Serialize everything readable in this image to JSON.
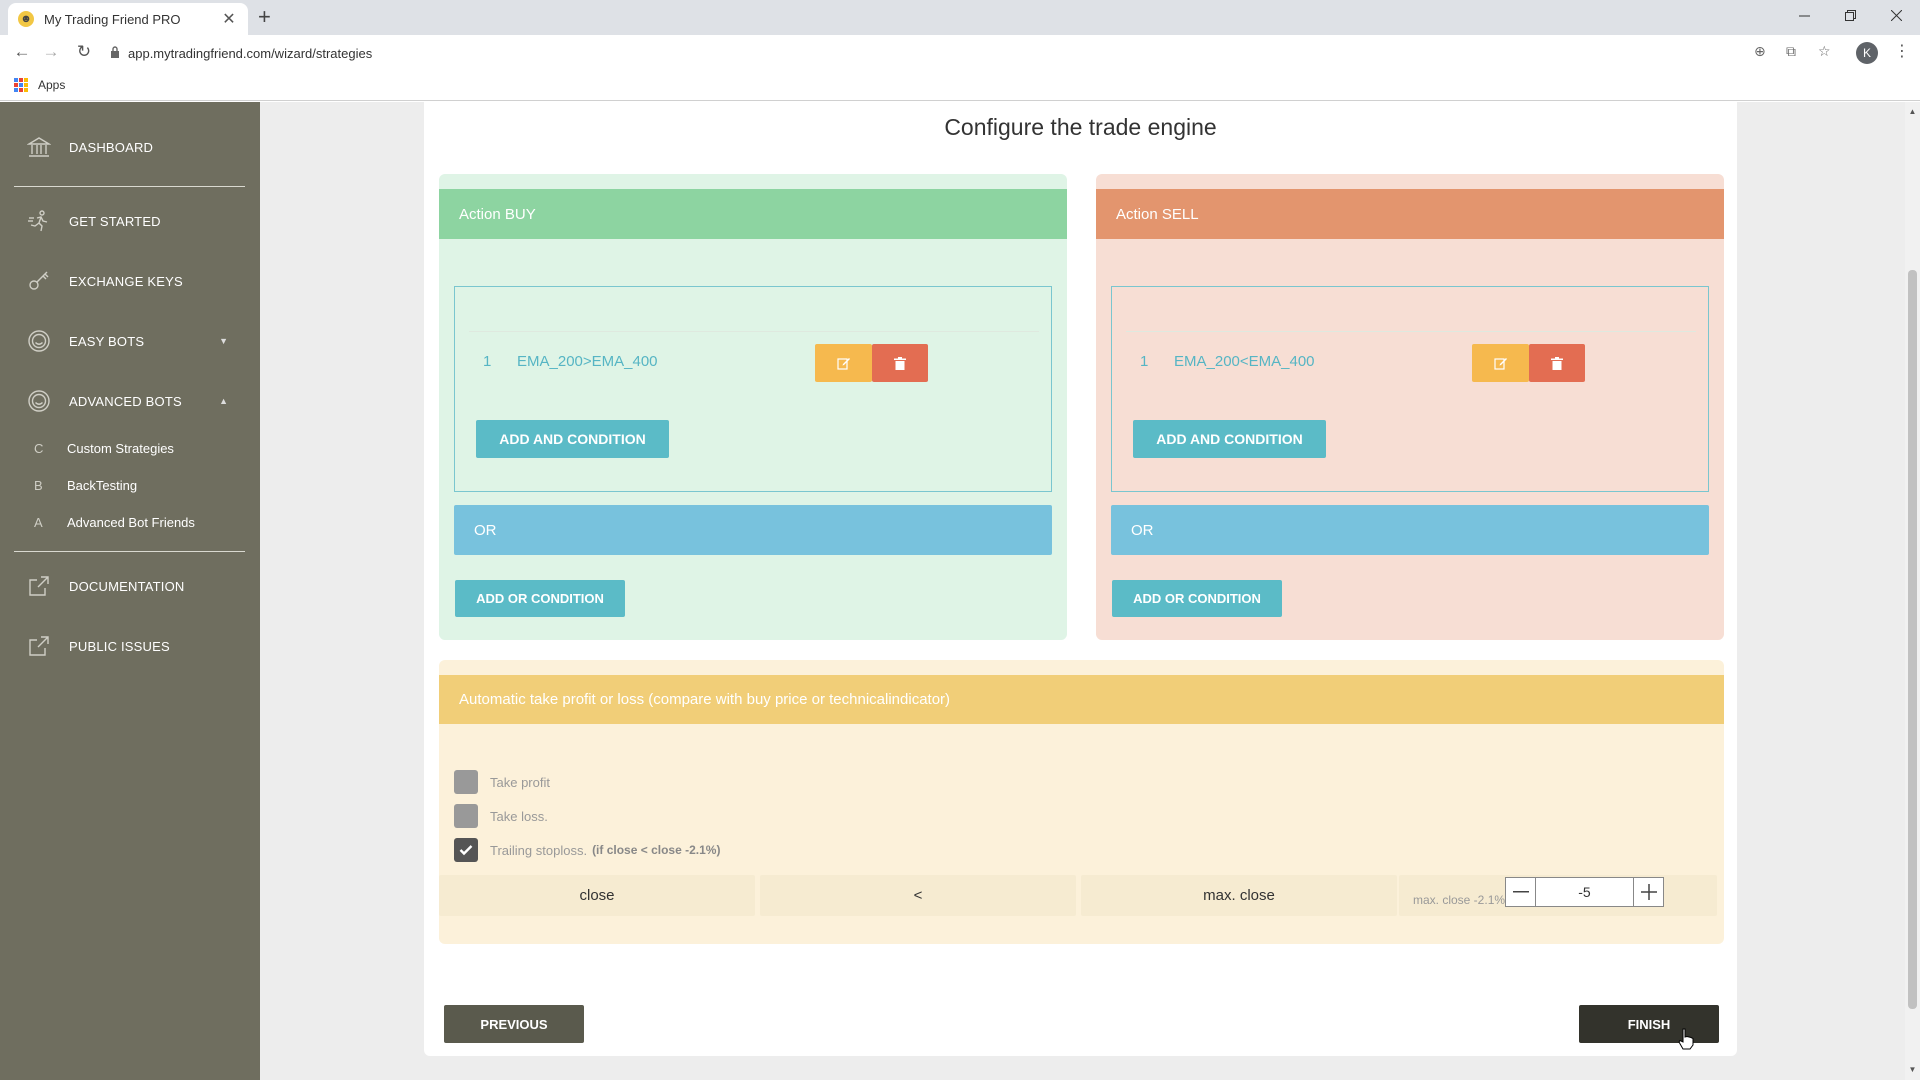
{
  "browser": {
    "tab_title": "My Trading Friend PRO",
    "tab_close": "✕",
    "new_tab": "+",
    "url": "app.mytradingfriend.com/wizard/strategies",
    "bookmarks_apps": "Apps",
    "profile_initial": "K"
  },
  "sidebar": {
    "items": [
      {
        "label": "DASHBOARD",
        "icon": "bank-icon"
      },
      {
        "label": "GET STARTED",
        "icon": "running-icon"
      },
      {
        "label": "EXCHANGE KEYS",
        "icon": "key-icon"
      },
      {
        "label": "EASY BOTS",
        "icon": "smile-icon"
      },
      {
        "label": "ADVANCED BOTS",
        "icon": "smile-icon"
      },
      {
        "label": "DOCUMENTATION",
        "icon": "external-link-icon"
      },
      {
        "label": "PUBLIC ISSUES",
        "icon": "external-link-icon"
      }
    ],
    "subitems": [
      {
        "letter": "C",
        "label": "Custom Strategies"
      },
      {
        "letter": "B",
        "label": "BackTesting"
      },
      {
        "letter": "A",
        "label": "Advanced Bot Friends"
      }
    ]
  },
  "main": {
    "title": "Configure the trade engine",
    "buy": {
      "header": "Action BUY",
      "condition_num": "1",
      "condition_text": "EMA_200>EMA_400",
      "add_and": "ADD AND CONDITION",
      "or_label": "OR",
      "add_or": "ADD OR CONDITION"
    },
    "sell": {
      "header": "Action SELL",
      "condition_num": "1",
      "condition_text": "EMA_200<EMA_400",
      "add_and": "ADD AND CONDITION",
      "or_label": "OR",
      "add_or": "ADD OR CONDITION"
    },
    "takeprofit": {
      "header": "Automatic take profit or loss (compare with buy price or technicalindicator)",
      "take_profit": "Take profit",
      "take_profit_checked": false,
      "take_loss": "Take loss.",
      "take_loss_checked": false,
      "trailing": "Trailing stoploss.",
      "trailing_note": "(if close < close -2.1%)",
      "trailing_checked": true,
      "expr_left": "close",
      "expr_op": "<",
      "expr_right": "max. close",
      "expr_hint": "max. close -2.1%",
      "stepper_value": "-5"
    },
    "previous": "PREVIOUS",
    "finish": "FINISH"
  },
  "colors": {
    "buy_header": "#8dd4a1",
    "sell_header": "#e3956e",
    "or_bar": "#78c2dd",
    "tp_header": "#f1ce78",
    "sidebar": "#6f6e5f"
  }
}
